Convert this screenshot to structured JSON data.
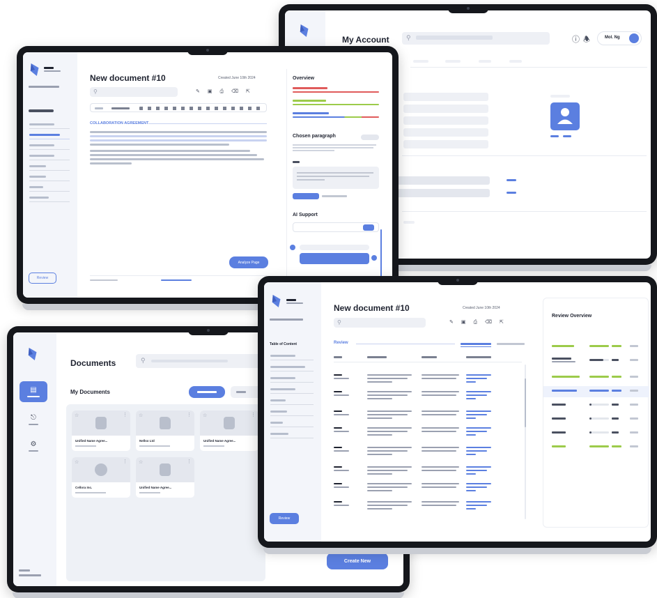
{
  "account": {
    "title": "My Account",
    "user_name": "Mol. Ng"
  },
  "editor": {
    "title": "New document #10",
    "created": "Created June 10th 2024",
    "overview_title": "Overview",
    "chosen_title": "Chosen paragraph",
    "ai_title": "AI Support",
    "analyze_label": "Analyze Page",
    "review_label": "Review",
    "heading": "COLLABORATION AGREEMENT"
  },
  "documents": {
    "title": "Documents",
    "my_docs": "My Documents",
    "create_label": "Create New",
    "cards": [
      {
        "name": "Unified Name Agree..."
      },
      {
        "name": "Nellso Ltd"
      },
      {
        "name": "Unified Name Agree..."
      },
      {
        "name": "Cellora Inc."
      },
      {
        "name": "Unified Name Agree..."
      }
    ]
  },
  "review": {
    "title": "New document #10",
    "created": "Created June 10th 2024",
    "toc_title": "Table of Content",
    "review_tab": "Review",
    "review_button": "Review",
    "panel_title": "Review Overview"
  },
  "colors": {
    "accent": "#5b7fe0",
    "sidebar": "#f3f5fa",
    "bezel": "#15171c"
  }
}
